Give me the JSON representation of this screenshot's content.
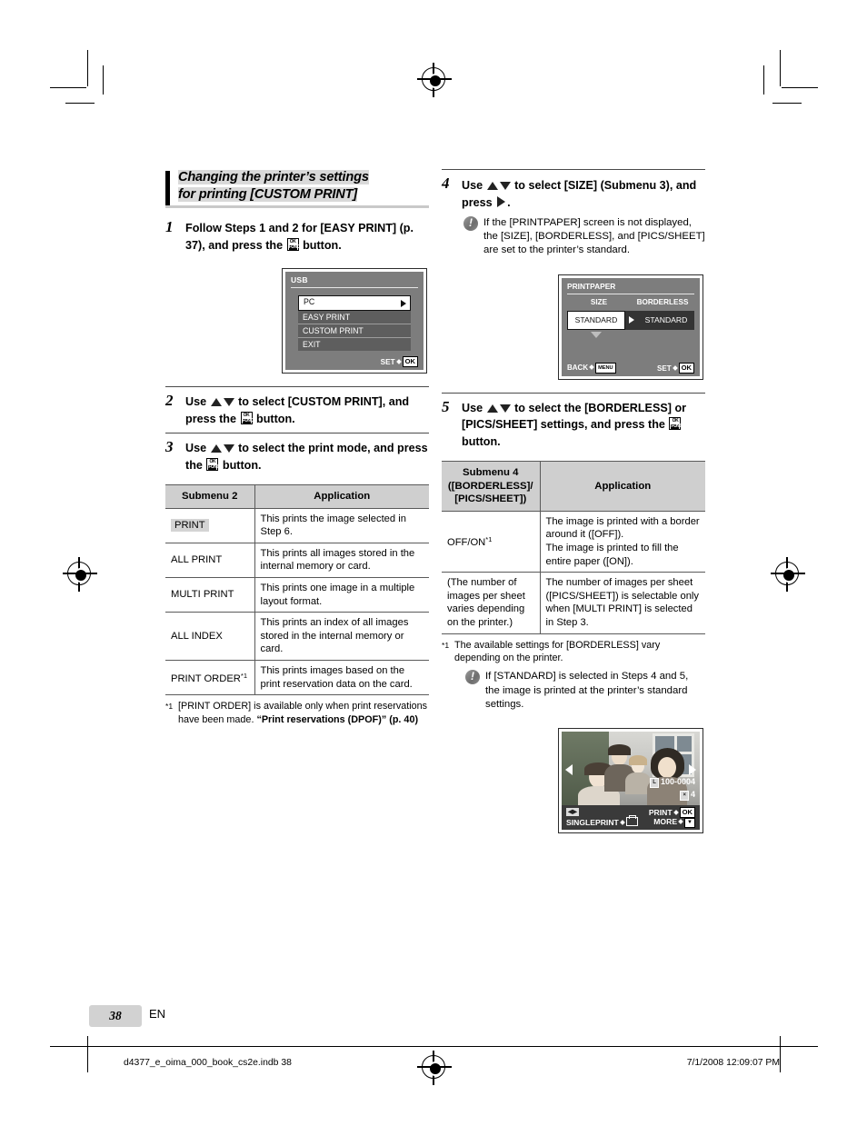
{
  "page": {
    "number": "38",
    "language": "EN",
    "footer_left": "d4377_e_oima_000_book_cs2e.indb   38",
    "footer_right": "7/1/2008   12:09:07 PM"
  },
  "section": {
    "title_line1": "Changing the printer’s settings",
    "title_line2": "for printing [CUSTOM PRINT]"
  },
  "steps": {
    "s1": {
      "num": "1",
      "text_a": "Follow Steps 1 and 2 for [EASY PRINT] (p. 37), and press the ",
      "text_b": " button."
    },
    "s2": {
      "num": "2",
      "text_a": "Use ",
      "text_b": " to select [CUSTOM PRINT], and press the ",
      "text_c": " button."
    },
    "s3": {
      "num": "3",
      "text_a": "Use ",
      "text_b": " to select the print mode, and press the ",
      "text_c": " button."
    },
    "s4": {
      "num": "4",
      "text_a": "Use ",
      "text_b": " to select [SIZE] (Submenu 3), and press ",
      "text_c": ".",
      "note": "If the [PRINTPAPER] screen is not displayed, the [SIZE], [BORDERLESS], and [PICS/SHEET] are set to the printer’s standard."
    },
    "s5": {
      "num": "5",
      "text_a": "Use ",
      "text_b": " to select the [BORDERLESS] or [PICS/SHEET] settings, and press the ",
      "text_c": " button."
    }
  },
  "table_submenu2": {
    "headers": [
      "Submenu 2",
      "Application"
    ],
    "rows": [
      {
        "name": "PRINT",
        "highlight": true,
        "sup": "",
        "application": "This prints the image selected in Step 6."
      },
      {
        "name": "ALL PRINT",
        "highlight": false,
        "sup": "",
        "application": "This prints all images stored in the internal memory or card."
      },
      {
        "name": "MULTI PRINT",
        "highlight": false,
        "sup": "",
        "application": "This prints one image in a multiple layout format."
      },
      {
        "name": "ALL INDEX",
        "highlight": false,
        "sup": "",
        "application": "This prints an index of all images stored in the internal memory or card."
      },
      {
        "name": "PRINT ORDER",
        "highlight": false,
        "sup": "*1",
        "application": "This prints images based on the print reservation data on the card."
      }
    ],
    "footnote_marker": "*1",
    "footnote_text": "[PRINT ORDER] is available only when print reservations have been made. ",
    "footnote_bold": "“Print reservations (DPOF)” (p. 40)"
  },
  "table_submenu4": {
    "header_col1_l1": "Submenu 4",
    "header_col1_l2": "([BORDERLESS]/",
    "header_col1_l3": "[PICS/SHEET])",
    "header_col2": "Application",
    "rows": [
      {
        "name": "OFF/ON",
        "sup": "*1",
        "application": "The image is printed with a border around it ([OFF]).\nThe image is printed to fill the entire paper ([ON])."
      },
      {
        "name": "(The number of images per sheet varies depending on the printer.)",
        "sup": "",
        "application": "The number of images per sheet ([PICS/SHEET]) is selectable only when [MULTI PRINT] is selected in Step 3."
      }
    ],
    "footnote_marker": "*1",
    "footnote_text": "The available settings for [BORDERLESS] vary depending on the printer.",
    "note": "If [STANDARD] is selected in Steps 4 and 5, the image is printed at the printer’s standard settings."
  },
  "lcd_usb": {
    "title": "USB",
    "items": [
      {
        "label": "PC",
        "selected": true
      },
      {
        "label": "EASY PRINT",
        "selected": false
      },
      {
        "label": "CUSTOM PRINT",
        "selected": false
      },
      {
        "label": "EXIT",
        "selected": false
      }
    ],
    "footer_label": "SET",
    "footer_button": "OK"
  },
  "lcd_printpaper": {
    "title": "PRINTPAPER",
    "col1_header": "SIZE",
    "col2_header": "BORDERLESS",
    "col1_value": "STANDARD",
    "col2_value": "STANDARD",
    "footer_back_label": "BACK",
    "footer_back_button": "MENU",
    "footer_set_label": "SET",
    "footer_set_button": "OK"
  },
  "lcd_photo": {
    "file_number": "100-0004",
    "copies": "4",
    "size_tag": "L",
    "copies_tag": "×",
    "left_label": "SINGLEPRINT",
    "right_label_1": "PRINT",
    "right_button_1": "OK",
    "right_label_2": "MORE",
    "right_button_2": "▼"
  },
  "icons": {
    "ok_func_button": "ok-func-button-icon",
    "up_arrow": "triangle-up-icon",
    "down_arrow": "triangle-down-icon",
    "right_arrow": "triangle-right-icon",
    "note": "exclamation-note-icon"
  },
  "colors": {
    "heading_highlight": "#d9d9d9",
    "table_header": "#cfcfcf",
    "lcd_background": "#7d7d7d",
    "page_badge": "#d2d2d2"
  }
}
